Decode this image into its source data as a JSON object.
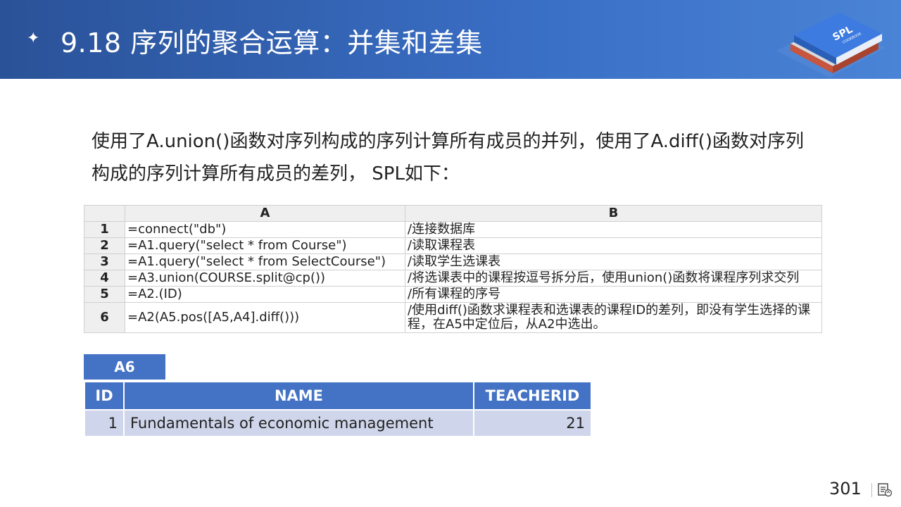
{
  "header": {
    "bullet": "✦",
    "title": "9.18 序列的聚合运算：并集和差集",
    "logo_text": "SPL",
    "logo_subtext": "COOKBOOK"
  },
  "body": {
    "paragraph": "使用了A.union()函数对序列构成的序列计算所有成员的并列，使用了A.diff()函数对序列构成的序列计算所有成员的差列， SPL如下："
  },
  "code_table": {
    "headers": [
      "",
      "A",
      "B"
    ],
    "rows": [
      {
        "num": "1",
        "a": "=connect(\"db\")",
        "b": "/连接数据库"
      },
      {
        "num": "2",
        "a": "=A1.query(\"select * from Course\")",
        "b": "/读取课程表"
      },
      {
        "num": "3",
        "a": "=A1.query(\"select * from SelectCourse\")",
        "b": "/读取学生选课表"
      },
      {
        "num": "4",
        "a": "=A3.union(COURSE.split@cp())",
        "b": "/将选课表中的课程按逗号拆分后，使用union()函数将课程序列求交列"
      },
      {
        "num": "5",
        "a": "=A2.(ID)",
        "b": "/所有课程的序号"
      },
      {
        "num": "6",
        "a": "=A2(A5.pos([A5,A4].diff()))",
        "b": "/使用diff()函数求课程表和选课表的课程ID的差列，即没有学生选择的课程，在A5中定位后，从A2中选出。"
      }
    ]
  },
  "result": {
    "label": "A6",
    "columns": [
      "ID",
      "NAME",
      "TEACHERID"
    ],
    "rows": [
      {
        "id": "1",
        "name": "Fundamentals of economic management",
        "teacherid": "21"
      }
    ]
  },
  "footer": {
    "page_number": "301"
  }
}
